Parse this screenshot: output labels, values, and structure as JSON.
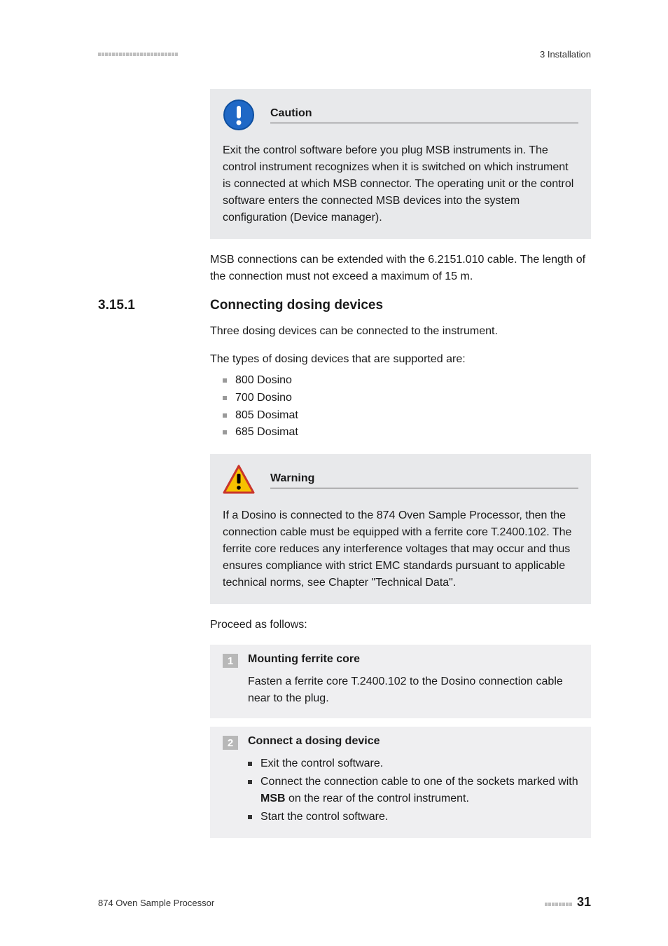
{
  "header": {
    "dash_count": 23,
    "chapter": "3 Installation"
  },
  "caution": {
    "title": "Caution",
    "body": "Exit the control software before you plug MSB instruments in. The control instrument recognizes when it is switched on which instrument is connected at which MSB connector. The operating unit or the control software enters the connected MSB devices into the system configuration (Device manager)."
  },
  "para_msb": "MSB connections can be extended with the 6.2151.010 cable. The length of the connection must not exceed a maximum of 15 m.",
  "section": {
    "num": "3.15.1",
    "title": "Connecting dosing devices"
  },
  "para_three": "Three dosing devices can be connected to the instrument.",
  "para_types": "The types of dosing devices that are supported are:",
  "devices": [
    "800 Dosino",
    "700 Dosino",
    "805 Dosimat",
    "685 Dosimat"
  ],
  "warning": {
    "title": "Warning",
    "body": "If a Dosino is connected to the 874 Oven Sample Processor, then the connection cable must be equipped with a ferrite core T.2400.102. The ferrite core reduces any interference voltages that may occur and thus ensures compliance with strict EMC standards pursuant to applicable technical norms, see Chapter \"Technical Data\"."
  },
  "proceed": "Proceed as follows:",
  "steps": [
    {
      "num": "1",
      "title": "Mounting ferrite core",
      "body": "Fasten a ferrite core T.2400.102 to the Dosino connection cable near to the plug."
    },
    {
      "num": "2",
      "title": "Connect a dosing device",
      "bullets_pre": "Exit the control software.",
      "bullets_mid_a": "Connect the connection cable to one of the sockets marked with ",
      "bullets_mid_b": "MSB",
      "bullets_mid_c": " on the rear of the control instrument.",
      "bullets_post": "Start the control software."
    }
  ],
  "footer": {
    "left": "874 Oven Sample Processor",
    "dash_count": 8,
    "page": "31"
  }
}
